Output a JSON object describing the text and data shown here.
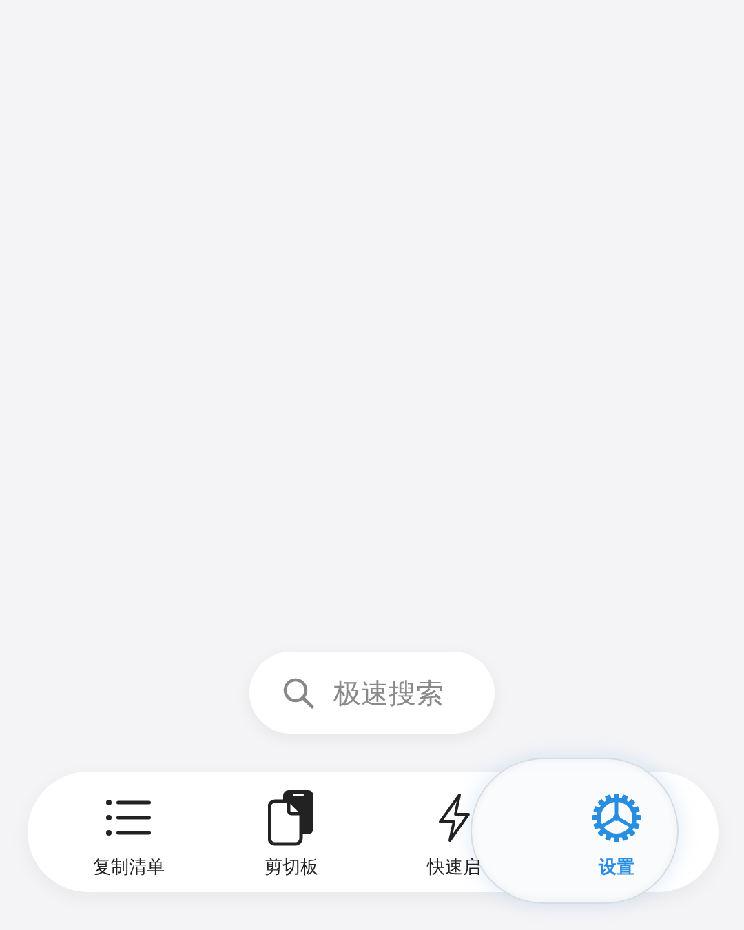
{
  "search": {
    "placeholder": "极速搜索"
  },
  "tabs": [
    {
      "label": "复制清单",
      "selected": false
    },
    {
      "label": "剪切板",
      "selected": false
    },
    {
      "label": "快速启",
      "selected": false
    },
    {
      "label": "设置",
      "selected": true
    }
  ]
}
